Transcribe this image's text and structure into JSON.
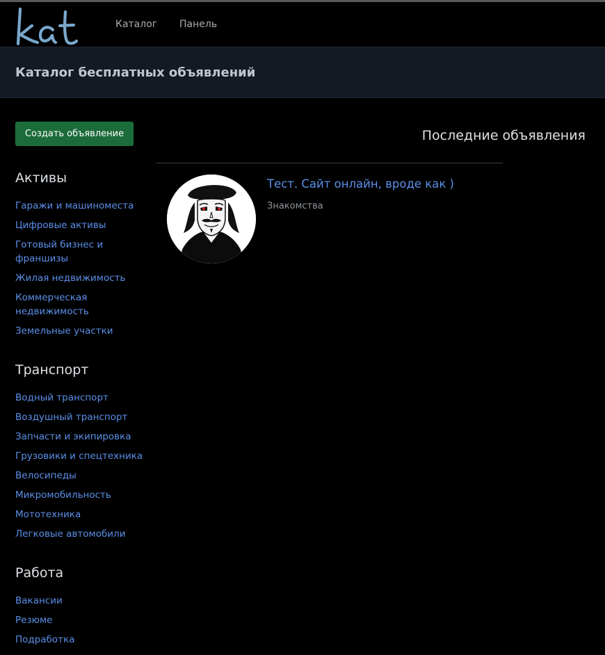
{
  "header": {
    "logo_text": "kat",
    "nav": [
      {
        "label": "Каталог"
      },
      {
        "label": "Панель"
      }
    ]
  },
  "banner": {
    "title": "Каталог бесплатных объявлений"
  },
  "sidebar": {
    "create_button": "Создать объявление",
    "sections": [
      {
        "title": "Активы",
        "items": [
          "Гаражи и машиноместа",
          "Цифровые активы",
          "Готовый бизнес и франшизы",
          "Жилая недвижимость",
          "Коммерческая недвижимость",
          "Земельные участки"
        ]
      },
      {
        "title": "Транспорт",
        "items": [
          "Водный транспорт",
          "Воздушный транспорт",
          "Запчасти и экипировка",
          "Грузовики и спецтехника",
          "Велосипеды",
          "Микромобильность",
          "Мототехника",
          "Легковые автомобили"
        ]
      },
      {
        "title": "Работа",
        "items": [
          "Вакансии",
          "Резюме",
          "Подработка"
        ]
      }
    ]
  },
  "main": {
    "latest_title": "Последние объявления",
    "listings": [
      {
        "title": "Тест. Сайт онлайн, вроде как )",
        "category": "Знакомства",
        "image_icon": "guy-fawkes-mask-avatar"
      }
    ]
  },
  "colors": {
    "link": "#5b8fe8",
    "button": "#1c6b3a",
    "banner_bg": "#141a23",
    "logo": "#7aa7cc"
  }
}
